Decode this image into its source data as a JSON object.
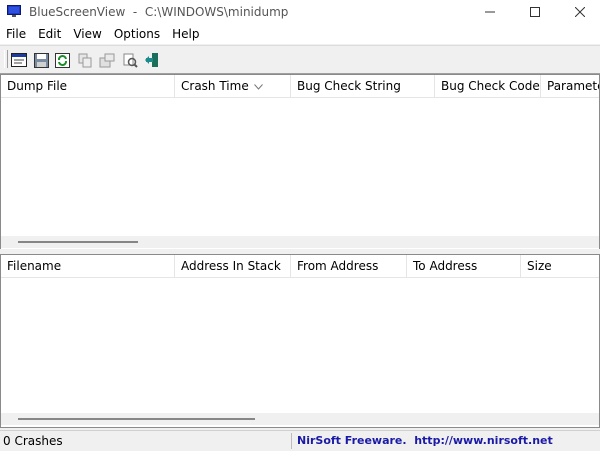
{
  "window": {
    "title": "BlueScreenView  -  C:\\WINDOWS\\minidump"
  },
  "menu": [
    "File",
    "Edit",
    "View",
    "Options",
    "Help"
  ],
  "toolbar": {
    "buttons": [
      {
        "icon": "properties-window-icon"
      },
      {
        "icon": "save-icon"
      },
      {
        "icon": "refresh-icon"
      },
      {
        "icon": "copy-icon"
      },
      {
        "icon": "html-report-icon"
      },
      {
        "icon": "find-icon"
      },
      {
        "icon": "exit-icon"
      }
    ]
  },
  "top_table": {
    "columns": [
      "Dump File",
      "Crash Time",
      "Bug Check String",
      "Bug Check Code",
      "Parameter"
    ],
    "sorted_column": "Crash Time",
    "rows": []
  },
  "bottom_table": {
    "columns": [
      "Filename",
      "Address In Stack",
      "From Address",
      "To Address",
      "Size"
    ],
    "rows": []
  },
  "status": {
    "count_text": "0 Crashes",
    "credit_text": "NirSoft Freeware.  http://www.nirsoft.net"
  },
  "colors": {
    "credit_link": "#1a1aa6",
    "toolbar_accent": "#1a8c2a"
  }
}
